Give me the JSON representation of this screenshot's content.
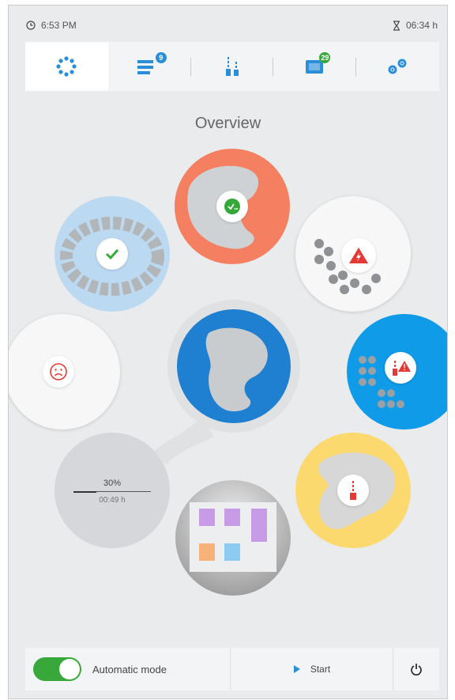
{
  "status": {
    "clock": "6:53 PM",
    "remaining": "06:34 h",
    "clock_icon": "clock-icon",
    "timer_icon": "hourglass-icon"
  },
  "tabs": [
    {
      "id": "overview",
      "icon": "overview-dots-icon",
      "active": true
    },
    {
      "id": "job-list",
      "icon": "list-icon",
      "badge": "9"
    },
    {
      "id": "tools",
      "icon": "tool-icon"
    },
    {
      "id": "materials",
      "icon": "material-icon",
      "badge": "29"
    },
    {
      "id": "settings",
      "icon": "gear-icon"
    }
  ],
  "title": "Overview",
  "progress": {
    "percent_label": "30%",
    "fraction": 0.3,
    "time": "00:49 h"
  },
  "colors": {
    "accent": "#2a8fd8",
    "salmon": "#f47f61",
    "success": "#36a83a",
    "warning": "#e53935",
    "yellow": "#fbd96e",
    "central": "#1f7fd0"
  },
  "bottom": {
    "auto_label": "Automatic mode",
    "auto_on": true,
    "start_label": "Start"
  }
}
